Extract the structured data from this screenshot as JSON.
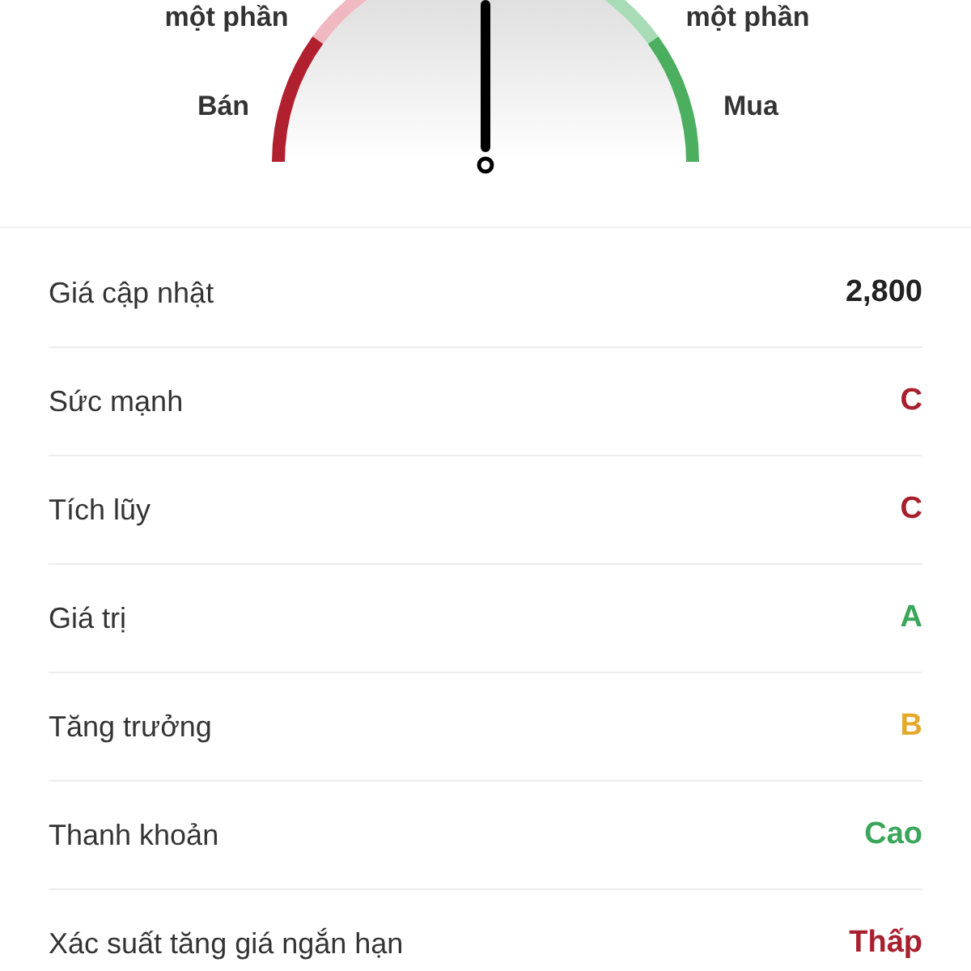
{
  "gauge": {
    "level": 0.5,
    "segments": [
      {
        "label": "một phần",
        "color": "#f0b8c0"
      },
      {
        "label": "một phần",
        "color": "#a8dcb6"
      },
      {
        "label": "Bán",
        "color": "#b0202f"
      },
      {
        "label": "Mua",
        "color": "#4cae5f"
      }
    ]
  },
  "rows": [
    {
      "label": "Giá cập nhật",
      "value": "2,800",
      "color": "#222222"
    },
    {
      "label": "Sức mạnh",
      "value": "C",
      "color": "#a8202e"
    },
    {
      "label": "Tích lũy",
      "value": "C",
      "color": "#a8202e"
    },
    {
      "label": "Giá trị",
      "value": "A",
      "color": "#3aa65a"
    },
    {
      "label": "Tăng trưởng",
      "value": "B",
      "color": "#e5a92a"
    },
    {
      "label": "Thanh khoản",
      "value": "Cao",
      "color": "#3aa65a"
    },
    {
      "label": "Xác suất tăng giá ngắn hạn",
      "value": "Thấp",
      "color": "#a8202e"
    }
  ]
}
